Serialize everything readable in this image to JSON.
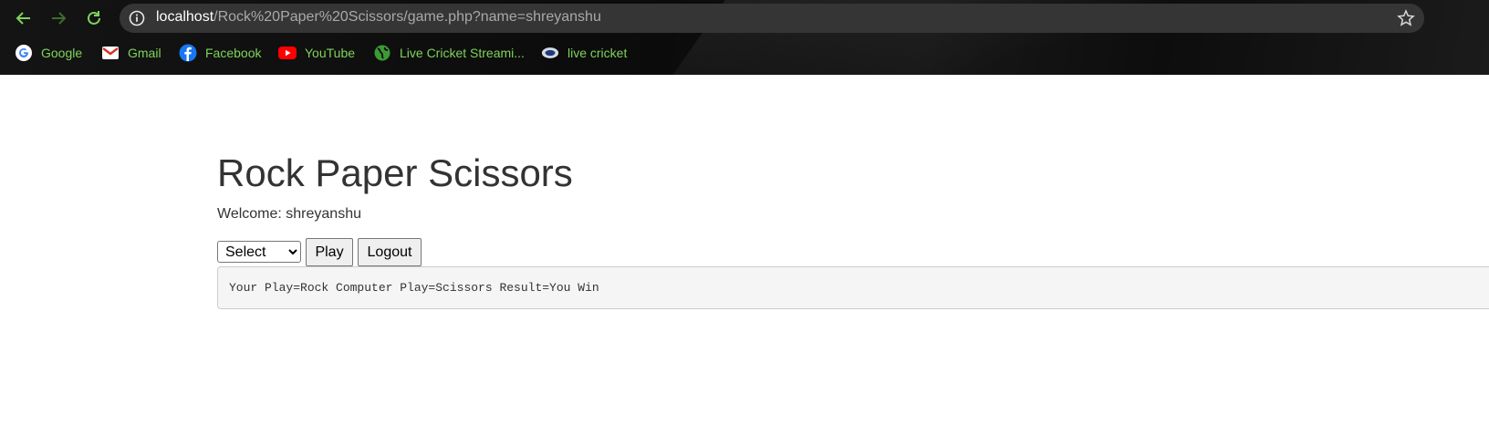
{
  "browser": {
    "url": {
      "host": "localhost",
      "path": "/Rock%20Paper%20Scissors/game.php?name=shreyanshu"
    },
    "icons": [
      "back-arrow-icon",
      "forward-arrow-icon",
      "reload-icon",
      "info-icon",
      "star-icon"
    ],
    "bookmarks": [
      {
        "label": "Google",
        "icon": "google-icon"
      },
      {
        "label": "Gmail",
        "icon": "gmail-icon"
      },
      {
        "label": "Facebook",
        "icon": "facebook-icon"
      },
      {
        "label": "YouTube",
        "icon": "youtube-icon"
      },
      {
        "label": "Live Cricket Streami...",
        "icon": "globe-icon"
      },
      {
        "label": "live cricket",
        "icon": "site-icon"
      }
    ],
    "colors": {
      "bookmark_text": "#7fd35a",
      "omnibox_bg": "#353535"
    }
  },
  "page": {
    "title": "Rock Paper Scissors",
    "welcome": "Welcome: shreyanshu",
    "select": {
      "selected": "Select"
    },
    "play_label": "Play",
    "logout_label": "Logout",
    "result": "Your Play=Rock Computer Play=Scissors Result=You Win"
  }
}
